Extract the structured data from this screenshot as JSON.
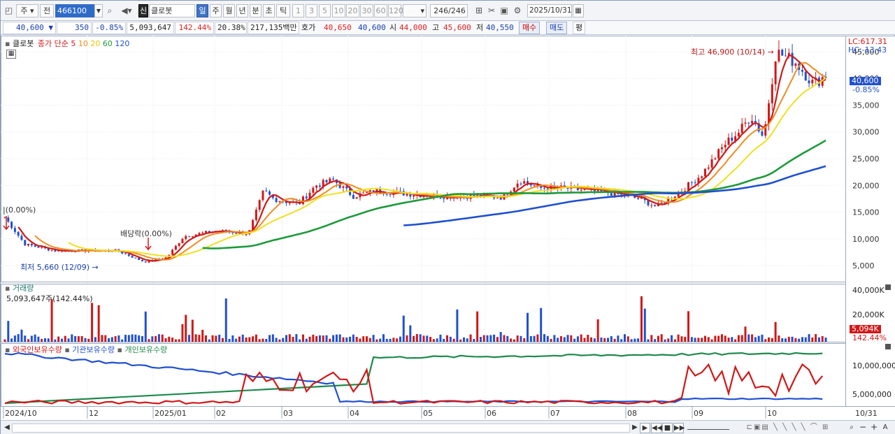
{
  "toolbar": {
    "period_type": "주",
    "prev_label": "전",
    "stock_code": "466100",
    "credit_badge": "신",
    "stock_name": "클로봇",
    "tabs": [
      "일",
      "주",
      "월",
      "년",
      "분",
      "초",
      "틱"
    ],
    "intervals": [
      "1",
      "3",
      "5",
      "10",
      "20",
      "30",
      "60",
      "120"
    ],
    "count": "246/246",
    "date": "2025/10/31"
  },
  "info": {
    "price": "40,600 ▼",
    "change": "350",
    "change_pct": "-0.85%",
    "volume": "5,093,647",
    "volume_ratio": "142.44%",
    "turnover": "20.38%",
    "trade_value": "217,135백만",
    "ask_label": "호가",
    "ask": "40,650",
    "bid": "40,600",
    "open_label": "시",
    "open": "44,000",
    "high_label": "고",
    "high": "45,600",
    "low_label": "저",
    "low": "40,550",
    "buy_label": "매수",
    "sell_label": "매도",
    "eval_label": "평"
  },
  "legend": {
    "name": "클로봇",
    "price_type": "종가 단순",
    "ma_periods": [
      "5",
      "10",
      "20",
      "60",
      "120"
    ],
    "ma_colors": [
      "#d01818",
      "#f08c22",
      "#f0e020",
      "#1e9a3c",
      "#2050d0"
    ]
  },
  "annotations": {
    "lc": "LC:617.31",
    "hc": "HC:-13.43",
    "high_marker": "최고 46,900 (10/14)",
    "low_marker": "최저 5,660 (12/09)",
    "dividend_marker": "배당락(0.00%)",
    "left_marker": "|(0.00%)",
    "price_badge": "40,600",
    "price_badge_pct": "-0.85%",
    "volume_badge": "5,094K",
    "volume_badge_pct": "142.44%"
  },
  "volume_panel": {
    "title": "거래량",
    "value": "5,093,647주(142.44%)",
    "y_ticks": [
      "40,000K",
      "20,000K"
    ]
  },
  "holding_panel": {
    "series": [
      "외국인보유수량",
      "기관보유수량",
      "개인보유수량"
    ],
    "series_colors": [
      "#d01818",
      "#2050d0",
      "#1e8a4c"
    ],
    "y_ticks": [
      "10,000,000",
      "5,000,000"
    ]
  },
  "chart_data": {
    "type": "candlestick",
    "y_ticks": [
      "45,000",
      "40,000",
      "35,000",
      "30,000",
      "25,000",
      "20,000",
      "15,000",
      "10,000",
      "5,000"
    ],
    "y_values": [
      45000,
      40000,
      35000,
      30000,
      25000,
      20000,
      15000,
      10000,
      5000
    ],
    "x_labels": [
      "2024/10",
      "12",
      "2025/01",
      "02",
      "03",
      "04",
      "05",
      "06",
      "07",
      "08",
      "09",
      "10",
      "10/31"
    ],
    "high": {
      "value": 46900,
      "date": "10/14"
    },
    "low": {
      "value": 5660,
      "date": "12/09"
    },
    "last": {
      "value": 40600,
      "change_pct": -0.85
    },
    "ma_series": [
      {
        "name": "5",
        "color": "#d01818"
      },
      {
        "name": "10",
        "color": "#f08c22"
      },
      {
        "name": "20",
        "color": "#f0e020"
      },
      {
        "name": "60",
        "color": "#1e9a3c"
      },
      {
        "name": "120",
        "color": "#2050d0"
      }
    ]
  },
  "bottom_icons": [
    "play",
    "first",
    "stop",
    "last",
    "zoom-out",
    "zoom-in",
    "add"
  ]
}
